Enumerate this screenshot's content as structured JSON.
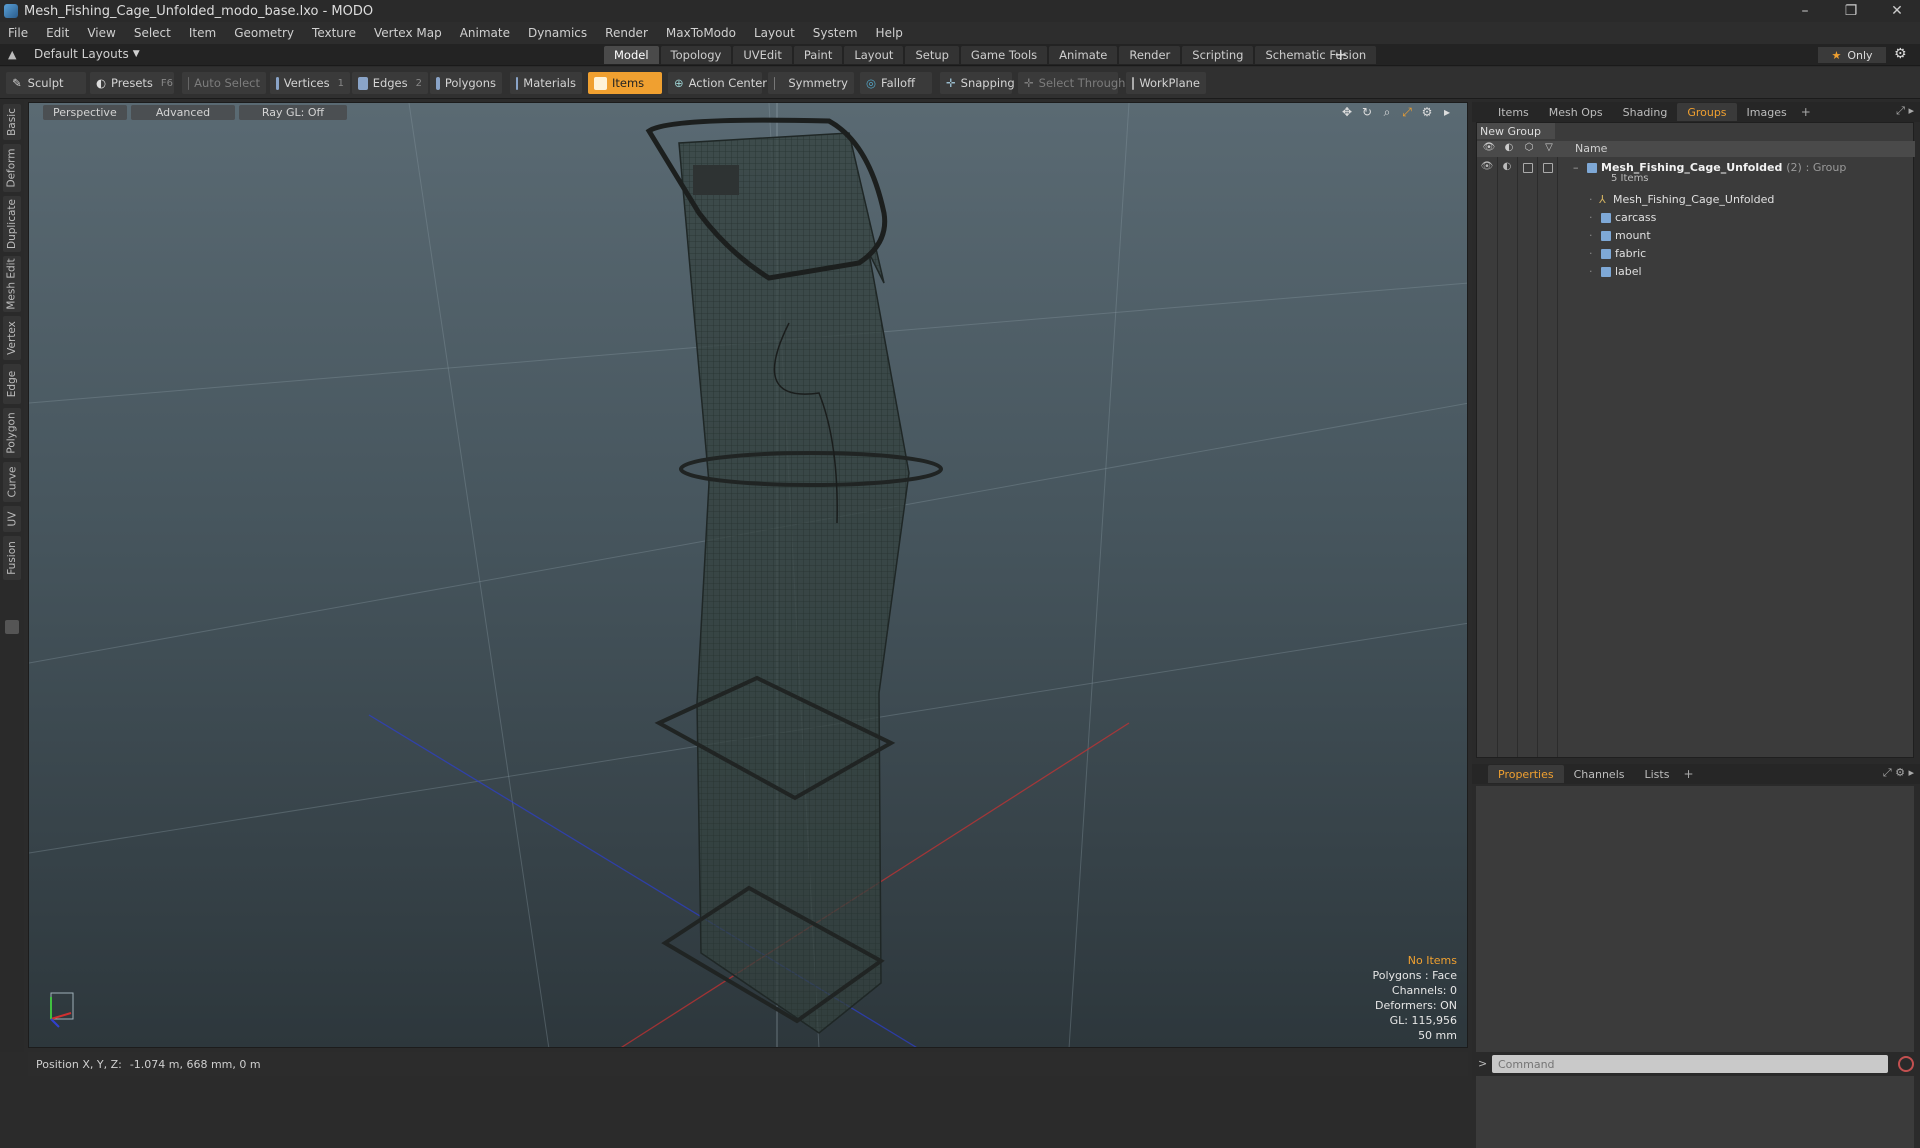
{
  "window": {
    "title": "Mesh_Fishing_Cage_Unfolded_modo_base.lxo - MODO",
    "controls": [
      "–",
      "❐",
      "✕"
    ]
  },
  "menu": [
    "File",
    "Edit",
    "View",
    "Select",
    "Item",
    "Geometry",
    "Texture",
    "Vertex Map",
    "Animate",
    "Dynamics",
    "Render",
    "MaxToModo",
    "Layout",
    "System",
    "Help"
  ],
  "layout_bar": {
    "layout_dropdown": "Default Layouts",
    "tabs": [
      "Model",
      "Topology",
      "UVEdit",
      "Paint",
      "Layout",
      "Setup",
      "Game Tools",
      "Animate",
      "Render",
      "Scripting",
      "Schematic Fusion"
    ],
    "active_tab": "Model",
    "only_label": "Only"
  },
  "toolbar": {
    "sculpt": "Sculpt",
    "presets": "Presets",
    "presets_key": "F6",
    "auto_select": "Auto Select",
    "vertices": "Vertices",
    "vertices_count": "1",
    "edges": "Edges",
    "edges_count": "2",
    "polygons": "Polygons",
    "materials": "Materials",
    "items": "Items",
    "action_center": "Action Center",
    "symmetry": "Symmetry",
    "falloff": "Falloff",
    "snapping": "Snapping",
    "select_through": "Select Through",
    "workplane": "WorkPlane"
  },
  "left_tabs": [
    "Basic",
    "Deform",
    "Duplicate",
    "Mesh Edit",
    "Vertex",
    "Edge",
    "Polygon",
    "Curve",
    "UV",
    "Fusion"
  ],
  "viewport": {
    "perspective": "Perspective",
    "advanced": "Advanced",
    "raygl": "Ray GL: Off",
    "info": {
      "items": "No Items",
      "polygons": "Polygons : Face",
      "channels": "Channels: 0",
      "deformers": "Deformers: ON",
      "gl": "GL: 115,956",
      "scale": "50 mm"
    }
  },
  "status": {
    "position_label": "Position X, Y, Z:",
    "position_value": "-1.074 m, 668 mm, 0 m"
  },
  "right_panel": {
    "top_tabs": [
      "Items",
      "Mesh Ops",
      "Shading",
      "Groups",
      "Images"
    ],
    "active_top_tab": "Groups",
    "new_group": "New Group",
    "name_header": "Name",
    "group": {
      "name": "Mesh_Fishing_Cage_Unfolded",
      "count": "(2)",
      "type": ": Group",
      "items_label": "5 Items",
      "children": [
        "Mesh_Fishing_Cage_Unfolded",
        "carcass",
        "mount",
        "fabric",
        "label"
      ]
    },
    "bottom_tabs": [
      "Properties",
      "Channels",
      "Lists"
    ],
    "active_bottom_tab": "Properties",
    "command_placeholder": "Command"
  },
  "colors": {
    "accent": "#f0a030",
    "item_cube": "#7ea8d6"
  }
}
